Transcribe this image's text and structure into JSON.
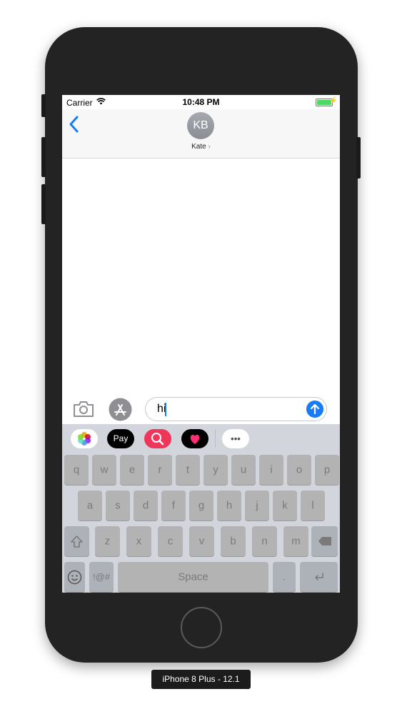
{
  "status_bar": {
    "carrier": "Carrier",
    "time": "10:48 PM",
    "battery_color": "#4cd964"
  },
  "header": {
    "back_icon": "chevron-left-icon",
    "avatar_initials": "KB",
    "contact_name": "Kate",
    "contact_chevron": "›"
  },
  "compose": {
    "camera_icon": "camera-icon",
    "appstore_icon": "app-store-icon",
    "message_text": "hi",
    "send_icon": "send-arrow-icon",
    "accent": "#1a7cf5"
  },
  "app_drawer": [
    {
      "name": "photos-icon"
    },
    {
      "name": "apple-pay-icon",
      "label": "Pay"
    },
    {
      "name": "image-search-icon"
    },
    {
      "name": "digital-touch-icon"
    },
    {
      "name": "more-apps-icon",
      "label": "•••"
    }
  ],
  "keyboard": {
    "row1": [
      "q",
      "w",
      "e",
      "r",
      "t",
      "y",
      "u",
      "i",
      "o",
      "p"
    ],
    "row2": [
      "a",
      "s",
      "d",
      "f",
      "g",
      "h",
      "j",
      "k",
      "l"
    ],
    "row3": [
      "z",
      "x",
      "c",
      "v",
      "b",
      "n",
      "m"
    ],
    "shift_icon": "shift-icon",
    "delete_icon": "delete-icon",
    "emoji_icon": "emoji-icon",
    "symbols_label": "!@#",
    "space_label": "Space",
    "period_label": ".",
    "return_icon": "return-icon"
  },
  "device_label": "iPhone 8 Plus - 12.1"
}
